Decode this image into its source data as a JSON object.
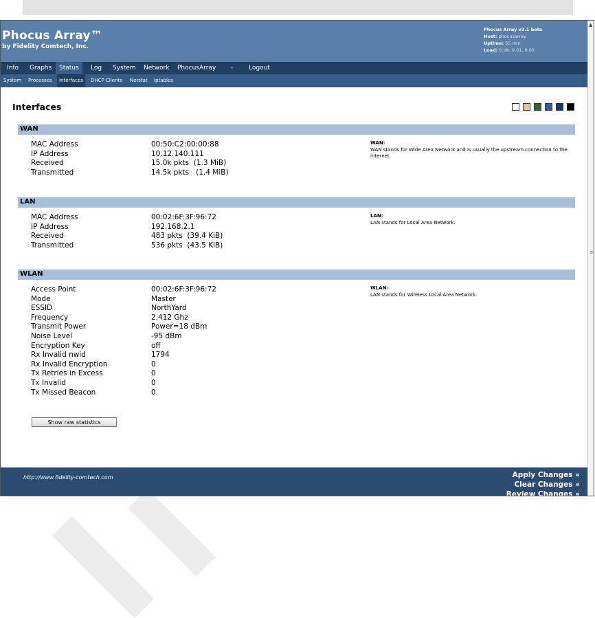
{
  "header": {
    "title": "Phocus Array™",
    "subtitle": "by Fidelity Comtech, Inc.",
    "version": "Phocus Array v2.1 beta",
    "host_label": "Host:",
    "host_value": "phocusarray",
    "uptime_label": "Uptime:",
    "uptime_value": "55 min",
    "load_label": "Load:",
    "load_value": "0.08, 0.01, 0.05"
  },
  "mainnav": [
    "Info",
    "Graphs",
    "Status",
    "Log",
    "System",
    "Network",
    "PhocusArray",
    "-",
    "Logout"
  ],
  "subnav": [
    "System",
    "Processes",
    "Interfaces",
    "DHCP Clients",
    "Netstat",
    "Iptables"
  ],
  "page_title": "Interfaces",
  "swatch_colors": [
    "#ffffff",
    "#e3c79a",
    "#2e6b2e",
    "#2a5fa6",
    "#1c3470",
    "#000000"
  ],
  "sections": {
    "wan": {
      "title": "WAN",
      "rows": [
        {
          "label": "MAC Address",
          "value": "00:50:C2:00:00:88"
        },
        {
          "label": "IP Address",
          "value": "10.12.140.111"
        },
        {
          "label": "Received",
          "value": "15.0k pkts  (1.3 MiB)"
        },
        {
          "label": "Transmitted",
          "value": "14.5k pkts   (1.4 MiB)"
        }
      ],
      "note_title": "WAN:",
      "note_text": "WAN stands for Wide Area Network and is usually the upstream connection to the internet."
    },
    "lan": {
      "title": "LAN",
      "rows": [
        {
          "label": "MAC Address",
          "value": "00:02:6F:3F:96:72"
        },
        {
          "label": "IP Address",
          "value": "192.168.2.1"
        },
        {
          "label": "Received",
          "value": "483 pkts  (39.4 KiB)"
        },
        {
          "label": "Transmitted",
          "value": "536 pkts  (43.5 KiB)"
        }
      ],
      "note_title": "LAN:",
      "note_text": "LAN stands for Local Area Network."
    },
    "wlan": {
      "title": "WLAN",
      "rows": [
        {
          "label": "Access Point",
          "value": "00:02:6F:3F:96:72"
        },
        {
          "label": "Mode",
          "value": "Master"
        },
        {
          "label": "ESSID",
          "value": "NorthYard"
        },
        {
          "label": "Frequency",
          "value": "2.412 Ghz"
        },
        {
          "label": "Transmit Power",
          "value": "Power=18 dBm"
        },
        {
          "label": "Noise Level",
          "value": "-95 dBm"
        },
        {
          "label": "Encryption Key",
          "value": "off"
        },
        {
          "label": "Rx Invalid nwid",
          "value": "1794"
        },
        {
          "label": "Rx Invalid Encryption",
          "value": "0"
        },
        {
          "label": "Tx Retries in Excess",
          "value": "0"
        },
        {
          "label": "Tx Invalid",
          "value": "0"
        },
        {
          "label": "Tx Missed Beacon",
          "value": "0"
        }
      ],
      "note_title": "WLAN:",
      "note_text": "LAN stands for Wireless Local Area Network."
    }
  },
  "raw_button": "Show raw statistics",
  "footer": {
    "url": "http://www.fidelity-comtech.com",
    "apply": "Apply Changes «",
    "clear": "Clear Changes «",
    "review": "Review Changes «"
  }
}
